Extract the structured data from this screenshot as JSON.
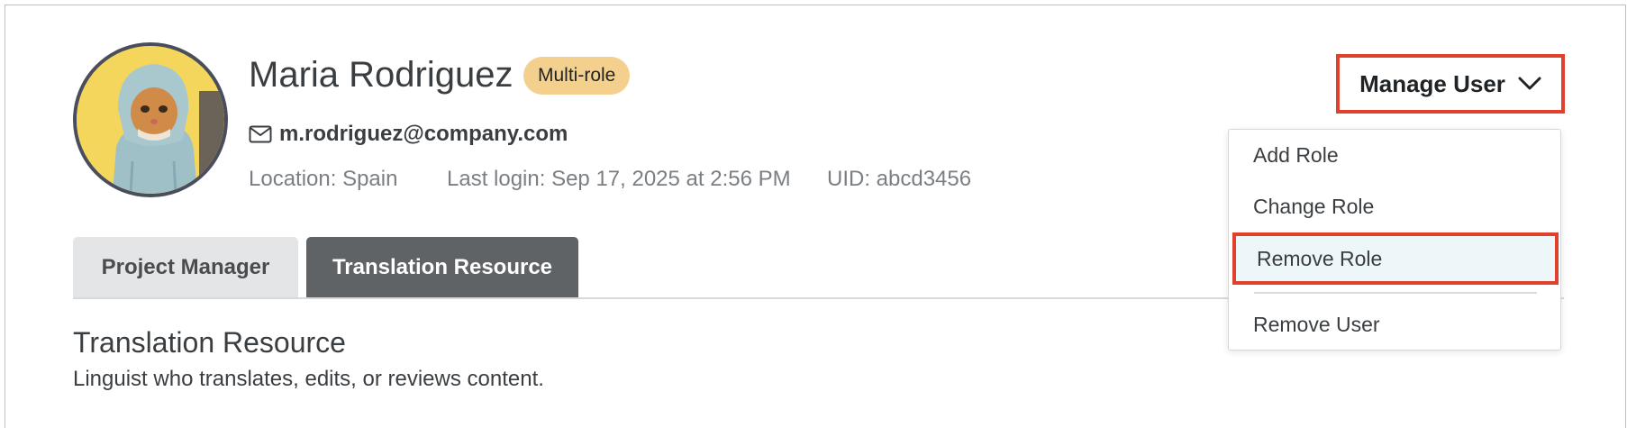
{
  "profile": {
    "name": "Maria Rodriguez",
    "badge": "Multi-role",
    "email": "m.rodriguez@company.com",
    "email_icon": "mail-icon",
    "location": "Location: Spain",
    "last_login": "Last login: Sep 17, 2025 at 2:56 PM",
    "uid": "UID: abcd3456"
  },
  "tabs": [
    {
      "label": "Project Manager",
      "active": false
    },
    {
      "label": "Translation Resource",
      "active": true
    }
  ],
  "section": {
    "title": "Translation Resource",
    "description": "Linguist who translates, edits, or reviews content."
  },
  "manage": {
    "label": "Manage User",
    "icon": "chevron-down-icon"
  },
  "menu": {
    "items": [
      {
        "label": "Add Role"
      },
      {
        "label": "Change Role"
      },
      {
        "label": "Remove Role",
        "highlighted": true
      },
      {
        "label": "Remove User"
      }
    ]
  },
  "colors": {
    "highlight_border": "#e0412c",
    "badge_bg": "#f4d08e",
    "active_tab_bg": "#5f6366",
    "avatar_bg": "#f3d65b"
  }
}
